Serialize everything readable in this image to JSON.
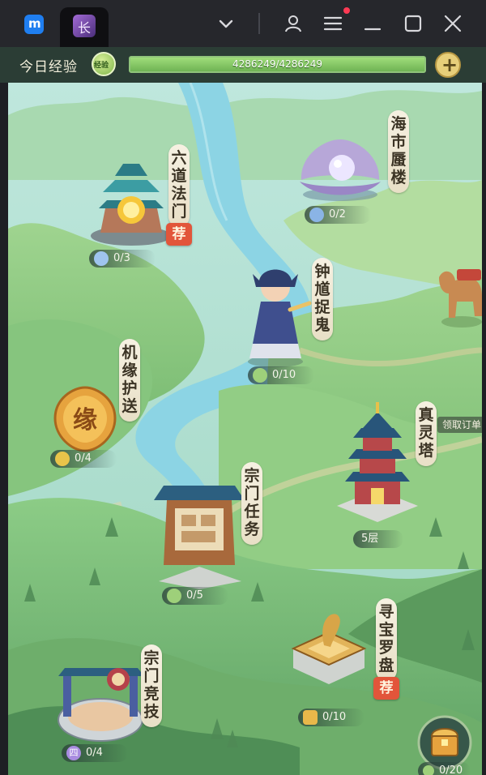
{
  "colors": {
    "titlebar": "#26272c",
    "xp_bar_bg": "#2b3d35",
    "xp_fill": "#8fd06a",
    "label_bg": "#f3eedc",
    "recommend_badge": "#e2553a",
    "river": "#8cd4e4"
  },
  "titlebar": {
    "app_logo_glyph": "m",
    "game_tab_glyph": "长",
    "icons": [
      "dropdown-chevron-icon",
      "account-icon",
      "menu-icon",
      "minimize-icon",
      "maximize-icon",
      "close-icon"
    ]
  },
  "xp": {
    "label": "今日经验",
    "badge_text": "经验",
    "current": 4286249,
    "max": 4286249,
    "text": "4286249/4286249",
    "progress": 1.0,
    "plus_glyph": "+"
  },
  "locations": {
    "liudao": {
      "name": "六道法门",
      "recommend": "荐",
      "counter": "0/3"
    },
    "haishi": {
      "name": "海市蜃楼",
      "counter": "0/2"
    },
    "zhongkui": {
      "name": "钟馗捉鬼",
      "counter": "0/10"
    },
    "jiyuan": {
      "name": "机缘护送",
      "counter": "0/4",
      "emblem": "缘"
    },
    "zhenling": {
      "name": "真灵塔",
      "counter": "5层"
    },
    "zongmen_task": {
      "name": "宗门任务",
      "counter": "0/5"
    },
    "xunbao": {
      "name": "寻宝罗盘",
      "recommend": "荐",
      "counter": "0/10"
    },
    "zongmen_arena": {
      "name": "宗门竞技",
      "counter": "0/4",
      "icon_glyph": "四"
    },
    "camel": {
      "label": "领取订单"
    },
    "chest": {
      "counter": "0/20"
    }
  }
}
